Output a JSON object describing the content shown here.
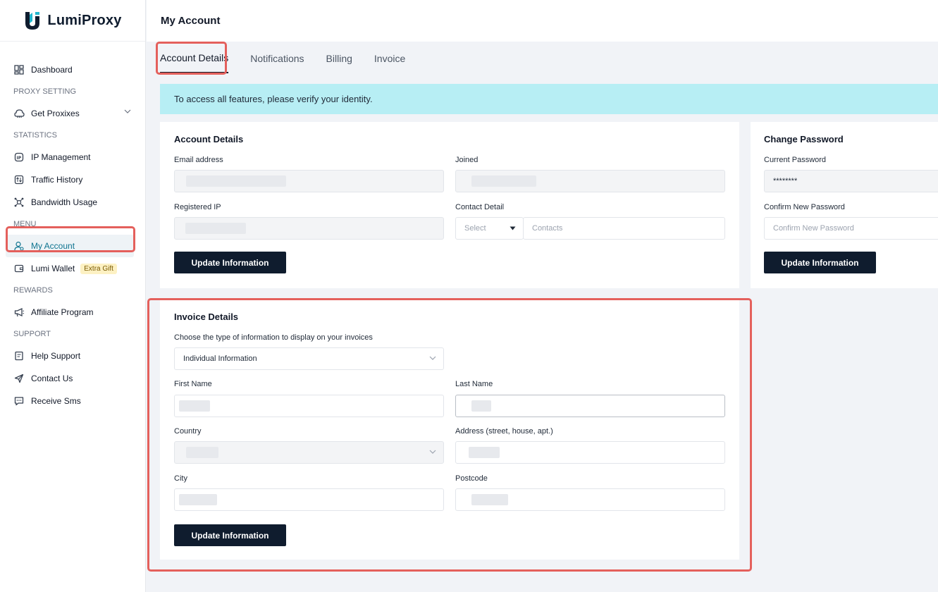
{
  "brand": {
    "name": "LumiProxy"
  },
  "sidebar": {
    "dashboard": "Dashboard",
    "section_proxy": "PROXY SETTING",
    "get_proxies": "Get Proxixes",
    "section_statistics": "STATISTICS",
    "ip_management": "IP Management",
    "traffic_history": "Traffic History",
    "bandwidth_usage": "Bandwidth Usage",
    "section_menu": "MENU",
    "my_account": "My Account",
    "lumi_wallet": "Lumi Wallet",
    "extra_gift": "Extra Gift",
    "section_rewards": "REWARDS",
    "affiliate_program": "Affiliate Program",
    "section_support": "SUPPORT",
    "help_support": "Help Support",
    "contact_us": "Contact Us",
    "receive_sms": "Receive Sms"
  },
  "header": {
    "title": "My Account"
  },
  "tabs": [
    "Account Details",
    "Notifications",
    "Billing",
    "Invoice"
  ],
  "banner": "To access all features, please verify your identity.",
  "account_details": {
    "title": "Account Details",
    "email_label": "Email address",
    "joined_label": "Joined",
    "registered_ip_label": "Registered IP",
    "contact_label": "Contact Detail",
    "contact_select_placeholder": "Select",
    "contacts_placeholder": "Contacts",
    "update_button": "Update Information"
  },
  "change_password": {
    "title": "Change Password",
    "current_label": "Current Password",
    "current_value": "********",
    "confirm_label": "Confirm New Password",
    "confirm_placeholder": "Confirm New Password",
    "update_button": "Update Information"
  },
  "invoice_details": {
    "title": "Invoice Details",
    "type_label": "Choose the type of information to display on your invoices",
    "type_value": "Individual Information",
    "first_name_label": "First Name",
    "last_name_label": "Last Name",
    "country_label": "Country",
    "address_label": "Address (street, house, apt.)",
    "city_label": "City",
    "postcode_label": "Postcode",
    "update_button": "Update Information"
  },
  "colors": {
    "accent": "#0e7490",
    "primary_button": "#0f1c2e",
    "banner_bg": "#b7eef4",
    "highlight": "#e4605c"
  }
}
